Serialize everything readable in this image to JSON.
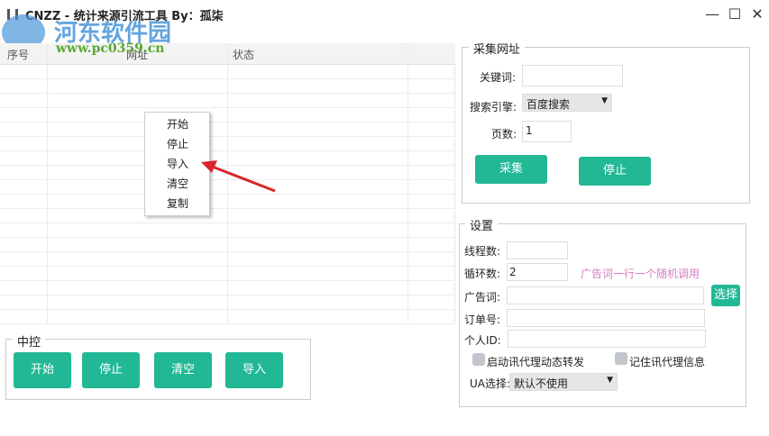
{
  "window": {
    "title": "CNZZ - 统计来源引流工具 By：孤柒",
    "watermark_name": "河东软件园",
    "watermark_url": "www.pc0359.cn"
  },
  "table": {
    "headers": [
      "序号",
      "网址",
      "状态"
    ]
  },
  "context_menu": {
    "items": [
      "开始",
      "停止",
      "导入",
      "清空",
      "复制"
    ]
  },
  "collect": {
    "title": "采集网址",
    "keyword_label": "关键词:",
    "keyword_value": "",
    "engine_label": "搜索引擎:",
    "engine_value": "百度搜索",
    "pages_label": "页数:",
    "pages_value": "1",
    "collect_btn": "采集",
    "stop_btn": "停止"
  },
  "settings": {
    "title": "设置",
    "threads_label": "线程数:",
    "threads_value": "",
    "loops_label": "循环数:",
    "loops_value": "2",
    "hint": "广告词一行一个随机调用",
    "ad_label": "广告词:",
    "ad_value": "",
    "select_btn": "选择",
    "order_label": "订单号:",
    "order_value": "",
    "id_label": "个人ID:",
    "id_value": "",
    "proxy_dynamic": "启动讯代理动态转发",
    "proxy_remember": "记住讯代理信息",
    "ua_label": "UA选择:",
    "ua_value": "默认不使用"
  },
  "control": {
    "title": "中控",
    "buttons": [
      "开始",
      "停止",
      "清空",
      "导入"
    ]
  },
  "colors": {
    "accent": "#22b895",
    "hint": "#d97cc0",
    "arrow": "#d9262c"
  }
}
